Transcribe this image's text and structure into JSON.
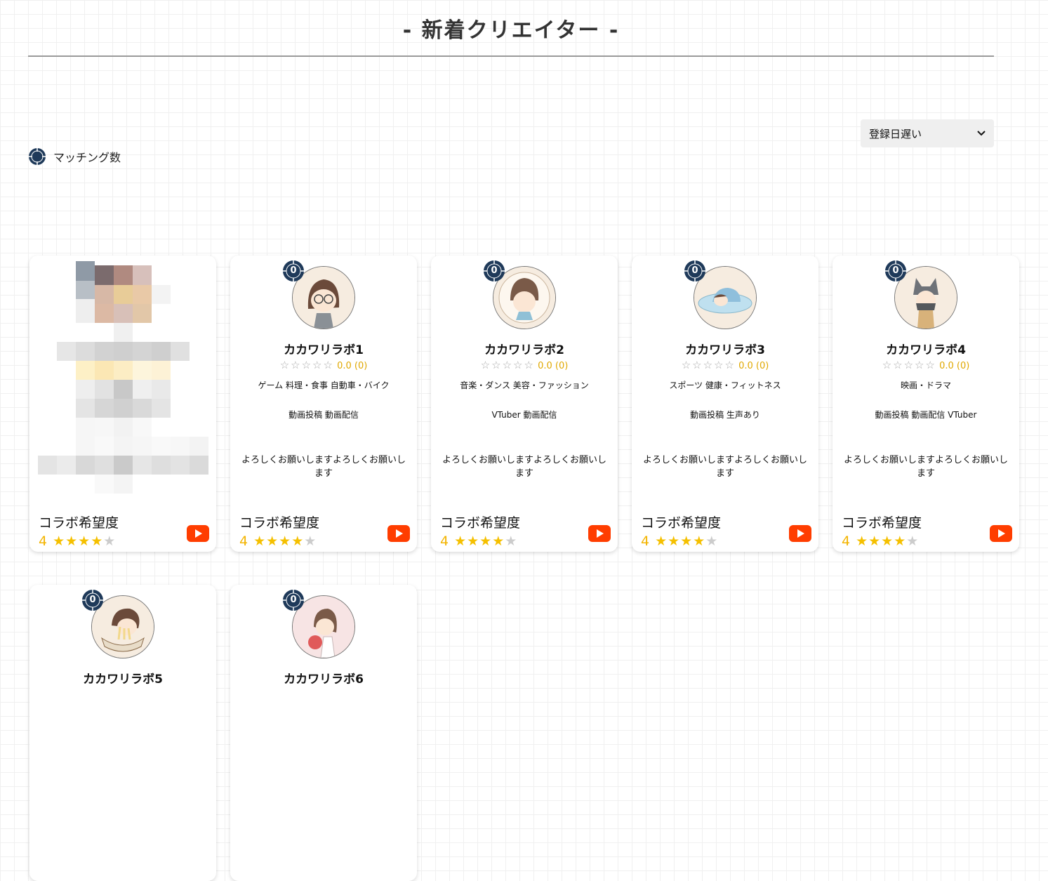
{
  "page": {
    "title": "- 新着クリエイター -"
  },
  "sort": {
    "selected": "登録日遅い"
  },
  "legend": {
    "label": "マッチング数"
  },
  "colors": {
    "navy": "#1f3a5a",
    "star_gold": "#f5c000",
    "youtube_red": "#ff3d00"
  },
  "cards": [
    {
      "name": "",
      "blurred": true,
      "collab_label": "コラボ希望度",
      "collab_score": "4",
      "collab_stars_on": "★★★★",
      "collab_stars_off": "★"
    },
    {
      "matching_count": "0",
      "name": "カカワリラボ1",
      "stars": "☆☆☆☆☆",
      "rating": "0.0 (0)",
      "genres": "ゲーム 料理・食事 自動車・バイク",
      "activities": "動画投稿 動画配信",
      "intro": "よろしくお願いしますよろしくお願いします",
      "collab_label": "コラボ希望度",
      "collab_score": "4",
      "collab_stars_on": "★★★★",
      "collab_stars_off": "★"
    },
    {
      "matching_count": "0",
      "name": "カカワリラボ2",
      "stars": "☆☆☆☆☆",
      "rating": "0.0 (0)",
      "genres": "音楽・ダンス 美容・ファッション",
      "activities": "VTuber 動画配信",
      "intro": "よろしくお願いしますよろしくお願いします",
      "collab_label": "コラボ希望度",
      "collab_score": "4",
      "collab_stars_on": "★★★★",
      "collab_stars_off": "★"
    },
    {
      "matching_count": "0",
      "name": "カカワリラボ3",
      "stars": "☆☆☆☆☆",
      "rating": "0.0 (0)",
      "genres": "スポーツ 健康・フィットネス",
      "activities": "動画投稿 生声あり",
      "intro": "よろしくお願いしますよろしくお願いします",
      "collab_label": "コラボ希望度",
      "collab_score": "4",
      "collab_stars_on": "★★★★",
      "collab_stars_off": "★"
    },
    {
      "matching_count": "0",
      "name": "カカワリラボ4",
      "stars": "☆☆☆☆☆",
      "rating": "0.0 (0)",
      "genres": "映画・ドラマ",
      "activities": "動画投稿 動画配信 VTuber",
      "intro": "よろしくお願いしますよろしくお願いします",
      "collab_label": "コラボ希望度",
      "collab_score": "4",
      "collab_stars_on": "★★★★",
      "collab_stars_off": "★"
    },
    {
      "matching_count": "0",
      "name": "カカワリラボ5"
    },
    {
      "matching_count": "0",
      "name": "カカワリラボ6"
    }
  ]
}
